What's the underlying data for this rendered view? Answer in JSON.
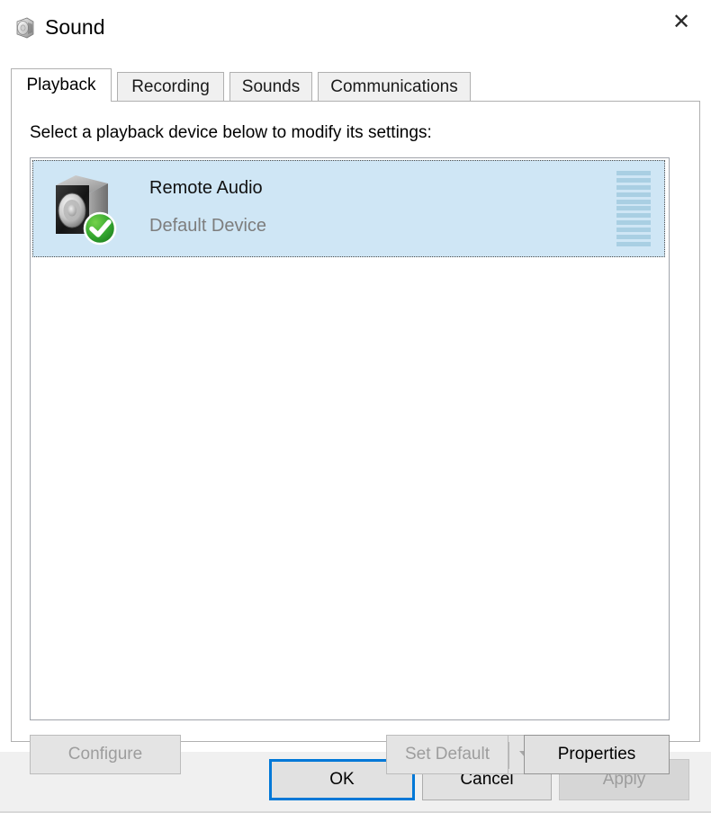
{
  "window": {
    "title": "Sound",
    "icon": "speaker-icon",
    "close_label": "✕"
  },
  "tabs": [
    {
      "label": "Playback",
      "active": true
    },
    {
      "label": "Recording",
      "active": false
    },
    {
      "label": "Sounds",
      "active": false
    },
    {
      "label": "Communications",
      "active": false
    }
  ],
  "playback": {
    "instruction": "Select a playback device below to modify its settings:",
    "devices": [
      {
        "name": "Remote Audio",
        "status": "Default Device",
        "selected": true,
        "icon": "speaker-device-icon",
        "badge": "default-device-check-icon",
        "meter_segments": 11,
        "meter_level": 0
      }
    ]
  },
  "actions": {
    "configure": {
      "label": "Configure",
      "enabled": false
    },
    "set_default": {
      "label": "Set Default",
      "enabled": false,
      "has_dropdown": true,
      "dropdown_icon": "chevron-down-icon"
    },
    "properties": {
      "label": "Properties",
      "enabled": true
    }
  },
  "footer": {
    "ok": {
      "label": "OK",
      "enabled": true,
      "is_default": true
    },
    "cancel": {
      "label": "Cancel",
      "enabled": true
    },
    "apply": {
      "label": "Apply",
      "enabled": false
    }
  },
  "colors": {
    "accent": "#0078d7",
    "selection_bg": "#cfe6f5",
    "meter_segment": "#a9cfe3",
    "dialog_bg": "#f0f0f0",
    "status_text": "#7d7d7d",
    "default_badge_green": "#2aa02a"
  }
}
